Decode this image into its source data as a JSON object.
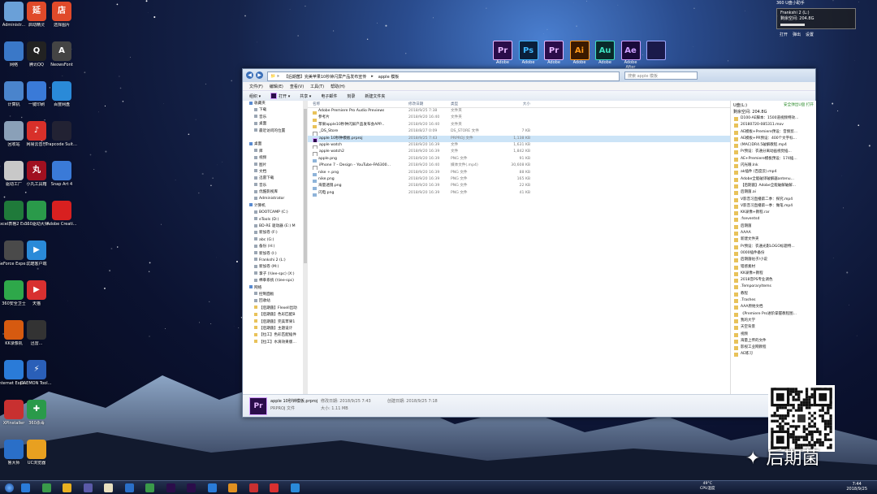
{
  "desktop_left": [
    {
      "label": "Administr...",
      "name": "administrator-icon",
      "color": "#6aa0d8"
    },
    {
      "label": "网络",
      "name": "network-icon",
      "color": "#3a78c8"
    },
    {
      "label": "计算机",
      "name": "computer-icon",
      "color": "#4a84cc"
    },
    {
      "label": "回收站",
      "name": "recycle-bin-icon",
      "color": "#8aa0b8"
    },
    {
      "label": "驱动工厂",
      "name": "driver-factory-icon",
      "color": "#c8c8c8"
    },
    {
      "label": "Excel表格2 Excel",
      "name": "excel-icon",
      "color": "#1f7a3a"
    },
    {
      "label": "GeForce Experience",
      "name": "geforce-icon",
      "color": "#4a4a4a"
    },
    {
      "label": "360安全卫士",
      "name": "360-safe-icon",
      "color": "#2ea84a"
    },
    {
      "label": "KK录像机",
      "name": "kk-recorder-icon",
      "color": "#d65a10"
    },
    {
      "label": "Internet Explorer",
      "name": "ie-icon",
      "color": "#2a7bd8"
    },
    {
      "label": "XPInstaller",
      "name": "xpinstaller-icon",
      "color": "#c83030"
    },
    {
      "label": "鲁大师",
      "name": "ludashi-icon",
      "color": "#2a6fc8"
    }
  ],
  "desktop_col2": [
    {
      "label": "启动精灵",
      "name": "qidong-icon",
      "color": "#e04a2a",
      "glyph": "延"
    },
    {
      "label": "腾讯QQ",
      "name": "qq-icon",
      "color": "#222",
      "glyph": "Q"
    },
    {
      "label": "一键印刷",
      "name": "print-icon",
      "color": "#3a7ad8",
      "glyph": ""
    },
    {
      "label": "网易云音乐",
      "name": "netease-music-icon",
      "color": "#d8302a",
      "glyph": "♪"
    },
    {
      "label": "小丸工具箱",
      "name": "xiaowan-icon",
      "color": "#a01020",
      "glyph": "丸"
    },
    {
      "label": "360驱动大师",
      "name": "360-driver-icon",
      "color": "#2a9a4a",
      "glyph": ""
    },
    {
      "label": "优酷客户端",
      "name": "youku-icon",
      "color": "#2a8ad8",
      "glyph": "▶"
    },
    {
      "label": "天猫",
      "name": "tmall-icon",
      "color": "#d83030",
      "glyph": "▶"
    },
    {
      "label": "迅雷...",
      "name": "thunder-icon",
      "color": "#333",
      "glyph": ""
    },
    {
      "label": "DAEMON Tools Lite",
      "name": "daemon-tools-icon",
      "color": "#2a5fb8",
      "glyph": "⚡"
    },
    {
      "label": "360杀毒",
      "name": "360-antivirus-icon",
      "color": "#2a9a4a",
      "glyph": "✚"
    },
    {
      "label": "UC浏览器",
      "name": "uc-browser-icon",
      "color": "#e8a020",
      "glyph": ""
    }
  ],
  "desktop_col3": [
    {
      "label": "选择图片",
      "name": "pick-image-icon",
      "color": "#e04a2a",
      "glyph": "店"
    },
    {
      "label": "NeowsFont",
      "name": "font-icon",
      "color": "#444",
      "glyph": "A"
    },
    {
      "label": "百度网盘",
      "name": "baidu-pan-icon",
      "color": "#2a8ad8",
      "glyph": ""
    },
    {
      "label": "Trapcode Suite 12.1...",
      "name": "trapcode-icon",
      "color": "#223",
      "glyph": ""
    },
    {
      "label": "Snap Art 4",
      "name": "snapart-icon",
      "color": "#3a7ad8",
      "glyph": ""
    },
    {
      "label": "Adobe Creati...",
      "name": "adobe-cc-icon",
      "color": "#d82020",
      "glyph": ""
    }
  ],
  "adobe_apps": [
    {
      "abbr": "Pr",
      "label": "Adobe",
      "name": "premiere-app-icon",
      "bg": "#2b0d4a",
      "fg": "#e7b8ff"
    },
    {
      "abbr": "Ps",
      "label": "Adobe",
      "name": "photoshop-app-icon",
      "bg": "#0a1f3a",
      "fg": "#3fb7ff"
    },
    {
      "abbr": "Pr",
      "label": "Adobe",
      "name": "premiere-app-icon-2",
      "bg": "#2b0d4a",
      "fg": "#e7b8ff"
    },
    {
      "abbr": "Ai",
      "label": "Adobe",
      "name": "illustrator-app-icon",
      "bg": "#3a1a00",
      "fg": "#ff9a1a"
    },
    {
      "abbr": "Au",
      "label": "Adobe",
      "name": "audition-app-icon",
      "bg": "#0a2a2a",
      "fg": "#3fe0c0"
    },
    {
      "abbr": "Ae",
      "label": "Adobe After",
      "name": "after-effects-app-icon",
      "bg": "#1a0a3a",
      "fg": "#cfa0ff"
    },
    {
      "abbr": "",
      "label": "",
      "name": "media-encoder-app-icon",
      "bg": "#1a1a4a",
      "fg": "#9fa8ff"
    }
  ],
  "window": {
    "address": [
      "【后期菌】完美苹果10秒钟闪屏产品发布宣传",
      "apple 模板"
    ],
    "search_placeholder": "搜索 apple 模板",
    "menu": [
      "文件(F)",
      "编辑(E)",
      "查看(V)",
      "工具(T)",
      "帮助(H)"
    ],
    "toolbar": {
      "organize": "组织 ▾",
      "open": "打开 ▾",
      "share": "共享 ▾",
      "email": "电子邮件",
      "burn": "刻录",
      "new_folder": "新建文件夹"
    },
    "nav": [
      {
        "t": "收藏夹",
        "k": "s"
      },
      {
        "t": "下载",
        "k": "d"
      },
      {
        "t": "音乐",
        "k": "d"
      },
      {
        "t": "桌面",
        "k": "d"
      },
      {
        "t": "最近访问的位置",
        "k": "d"
      },
      {
        "t": "",
        "k": ""
      },
      {
        "t": "桌面",
        "k": "s"
      },
      {
        "t": "库",
        "k": "d"
      },
      {
        "t": "视频",
        "k": "d"
      },
      {
        "t": "图片",
        "k": "d"
      },
      {
        "t": "文档",
        "k": "d"
      },
      {
        "t": "迅雷下载",
        "k": "d"
      },
      {
        "t": "音乐",
        "k": "d"
      },
      {
        "t": "优酷影视库",
        "k": "d"
      },
      {
        "t": "Administrator",
        "k": "d"
      },
      {
        "t": "计算机",
        "k": "s"
      },
      {
        "t": "BOOTCAMP (C:)",
        "k": "d"
      },
      {
        "t": "eTools (D:)",
        "k": "d"
      },
      {
        "t": "BD-RE 驱动器 (E:) M",
        "k": "d"
      },
      {
        "t": "新加卷 (F:)",
        "k": "d"
      },
      {
        "t": "abc (G:)",
        "k": "d"
      },
      {
        "t": "备份 (H:)",
        "k": "d"
      },
      {
        "t": "新加卷 (I:)",
        "k": "d"
      },
      {
        "t": "Frankshi 2 (L:)",
        "k": "d"
      },
      {
        "t": "新加卷 (M:)",
        "k": "d"
      },
      {
        "t": "掌子 (\\\\lee-spc) (X:)",
        "k": "d"
      },
      {
        "t": "棉拳系统 (\\\\lee-spc)",
        "k": "d"
      },
      {
        "t": "网络",
        "k": "s"
      },
      {
        "t": "控制面板",
        "k": "d"
      },
      {
        "t": "回收站",
        "k": "d"
      },
      {
        "t": "【后期菌】Flexell出动",
        "k": "f"
      },
      {
        "t": "【后期菌】色彩匹配B",
        "k": "f"
      },
      {
        "t": "【后期菌】完美苹果1",
        "k": "f"
      },
      {
        "t": "【后期菌】主题设计",
        "k": "f"
      },
      {
        "t": "【拉工】色彩匹配插件",
        "k": "f"
      },
      {
        "t": "【拉工】水滴效果版…",
        "k": "f"
      }
    ],
    "columns": {
      "name": "名称",
      "date": "修改日期",
      "type": "类型",
      "size": "大小"
    },
    "files": [
      {
        "name": "Adobe Premiere Pro Audio Previews",
        "date": "2018/9/25 7:38",
        "type": "文件夹",
        "size": "",
        "icon": "folder",
        "sel": false
      },
      {
        "name": "参考片",
        "date": "2018/9/20 16:40",
        "type": "文件夹",
        "size": "",
        "icon": "folder",
        "sel": false
      },
      {
        "name": "苹果apple10秒钟闪屏产品发布会APP...",
        "date": "2018/9/20 16:40",
        "type": "文件夹",
        "size": "",
        "icon": "folder",
        "sel": false
      },
      {
        "name": "_DS_Store",
        "date": "2018/8/27 0:09",
        "type": "DS_STORE 文件",
        "size": "7 KB",
        "icon": "file",
        "sel": false
      },
      {
        "name": "apple 10秒钟模板.prproj",
        "date": "2018/9/25 7:43",
        "type": "PRPROJ 文件",
        "size": "1,138 KB",
        "icon": "pr",
        "sel": true
      },
      {
        "name": "apple watch",
        "date": "2018/9/20 16:39",
        "type": "文件",
        "size": "1,631 KB",
        "icon": "file",
        "sel": false
      },
      {
        "name": "apple watch2",
        "date": "2018/9/20 16:39",
        "type": "文件",
        "size": "1,842 KB",
        "icon": "file",
        "sel": false
      },
      {
        "name": "apple.png",
        "date": "2018/9/20 16:39",
        "type": "PNG 文件",
        "size": "91 KB",
        "icon": "img",
        "sel": false
      },
      {
        "name": "iPhone 7 – Design – YouTube-FA6300...",
        "date": "2018/9/20 16:40",
        "type": "媒体文件(.mp4)",
        "size": "30,608 KB",
        "icon": "file",
        "sel": false
      },
      {
        "name": "nike +.png",
        "date": "2018/9/20 16:39",
        "type": "PNG 文件",
        "size": "88 KB",
        "icon": "img",
        "sel": false
      },
      {
        "name": "nike.png",
        "date": "2018/9/20 16:39",
        "type": "PNG 文件",
        "size": "165 KB",
        "icon": "img",
        "sel": false
      },
      {
        "name": "海量透镜.png",
        "date": "2018/9/20 16:39",
        "type": "PNG 文件",
        "size": "22 KB",
        "icon": "img",
        "sel": false
      },
      {
        "name": "闪电.png",
        "date": "2018/9/20 16:39",
        "type": "PNG 文件",
        "size": "41 KB",
        "icon": "img",
        "sel": false
      }
    ],
    "right_pane": {
      "title": "U盘(L:)",
      "link": "安全弹出U盘 打开",
      "free": "剩余空间: 204.8G",
      "items": [
        "D100-AE脚本：1500道视频特效...",
        "20180720-085311.mov",
        "AE模板+Premiere预设：音频剪...",
        "AE模板+PR预设：400个文字标...",
        "(MAC)DR4.5破解教程.mp4",
        "Pr预设：衣通分离动画视觉插...",
        "AE+Premiere模板预设：174插...",
        "闪光眼.lnk",
        "ak插件 (百度云).mp4",
        "Adobe全能破译破解器antenu...",
        "【后期菌】Adobe全能破解破解...",
        "后期菌.ai",
        "V影音习直播第二季：探究.mp4",
        "V影音习直播第一季：做笔.mp4",
        "KK录像+教程.rar",
        ".fseventsd",
        "后期菌",
        "AAAA",
        "新建文件夹",
        "Pr预设：衣通光影LOGO标题特...",
        "0000插件备份",
        "后期菌帖子/小说",
        "错感素材",
        "KK录像+教程",
        "2018音PS专业调色",
        ".TemporaryItems",
        "教程",
        ".Trashes",
        "AAA原始文档",
        "《Premiere Pro进阶掌握教程图...",
        "我的大学",
        "天空背景",
        "视频",
        "海量上传的文件",
        "影视工业网教程",
        "AE练习"
      ]
    },
    "details": {
      "filename": "apple 10秒钟模板.prproj",
      "mod_label": "修改日期: 2018/9/25 7:43",
      "created_label": "创建日期: 2018/9/25 7:18",
      "type": "PRPROJ 文件",
      "size_label": "大小: 1.11 MB"
    }
  },
  "widget": {
    "top": "360 U盘小助手",
    "drive": "Frankshi 2 (L:)",
    "free": "剩余空间: 204.8G",
    "btns": [
      "打开",
      "弹出",
      "设置"
    ]
  },
  "taskbar": {
    "cpu_temp": "49°C",
    "cpu_label": "CPU温度",
    "time": "7:44",
    "date": "2018/9/25"
  },
  "brand": "后期菌"
}
